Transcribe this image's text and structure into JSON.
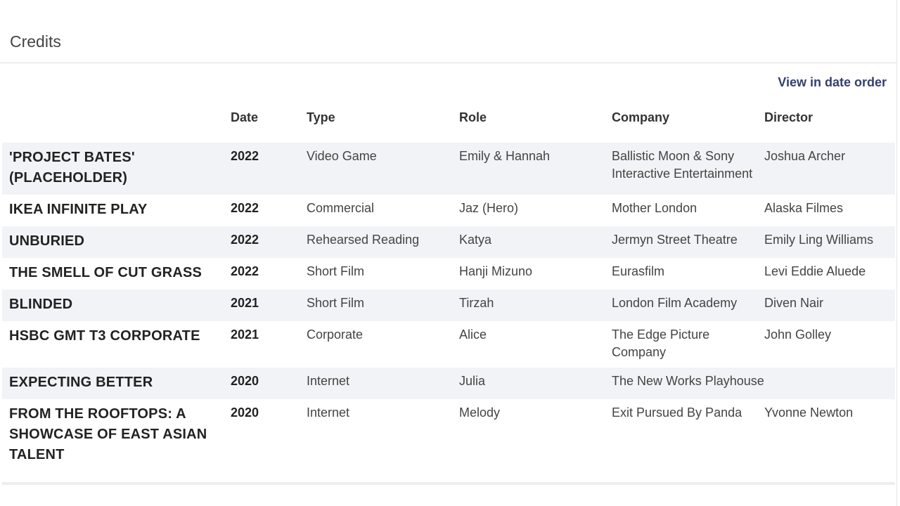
{
  "panel": {
    "title": "Credits",
    "view_link": "View in date order"
  },
  "table": {
    "headers": [
      "",
      "Date",
      "Type",
      "Role",
      "Company",
      "Director"
    ],
    "rows": [
      {
        "title": "'PROJECT BATES' (PLACEHOLDER)",
        "date": "2022",
        "type": "Video Game",
        "role": "Emily & Hannah",
        "company": "Ballistic Moon & Sony Interactive Entertainment",
        "director": "Joshua Archer"
      },
      {
        "title": "IKEA INFINITE PLAY",
        "date": "2022",
        "type": "Commercial",
        "role": "Jaz (Hero)",
        "company": "Mother London",
        "director": "Alaska Filmes"
      },
      {
        "title": "UNBURIED",
        "date": "2022",
        "type": "Rehearsed Reading",
        "role": "Katya",
        "company": "Jermyn Street Theatre",
        "director": "Emily Ling Williams"
      },
      {
        "title": "THE SMELL OF CUT GRASS",
        "date": "2022",
        "type": "Short Film",
        "role": "Hanji Mizuno",
        "company": "Eurasfilm",
        "director": "Levi Eddie Aluede"
      },
      {
        "title": "BLINDED",
        "date": "2021",
        "type": "Short Film",
        "role": "Tirzah",
        "company": "London Film Academy",
        "director": "Diven Nair"
      },
      {
        "title": "HSBC GMT T3 CORPORATE",
        "date": "2021",
        "type": "Corporate",
        "role": "Alice",
        "company": "The Edge Picture Company",
        "director": "John Golley"
      },
      {
        "title": "EXPECTING BETTER",
        "date": "2020",
        "type": "Internet",
        "role": "Julia",
        "company": "The New Works Playhouse",
        "director": ""
      },
      {
        "title": "FROM THE ROOFTOPS: A SHOWCASE OF EAST ASIAN TALENT",
        "date": "2020",
        "type": "Internet",
        "role": "Melody",
        "company": "Exit Pursued By Panda",
        "director": "Yvonne Newton"
      }
    ]
  },
  "colors": {
    "link": "#34406e",
    "row_shade": "#f2f3f6",
    "divider": "#d9dde3"
  }
}
